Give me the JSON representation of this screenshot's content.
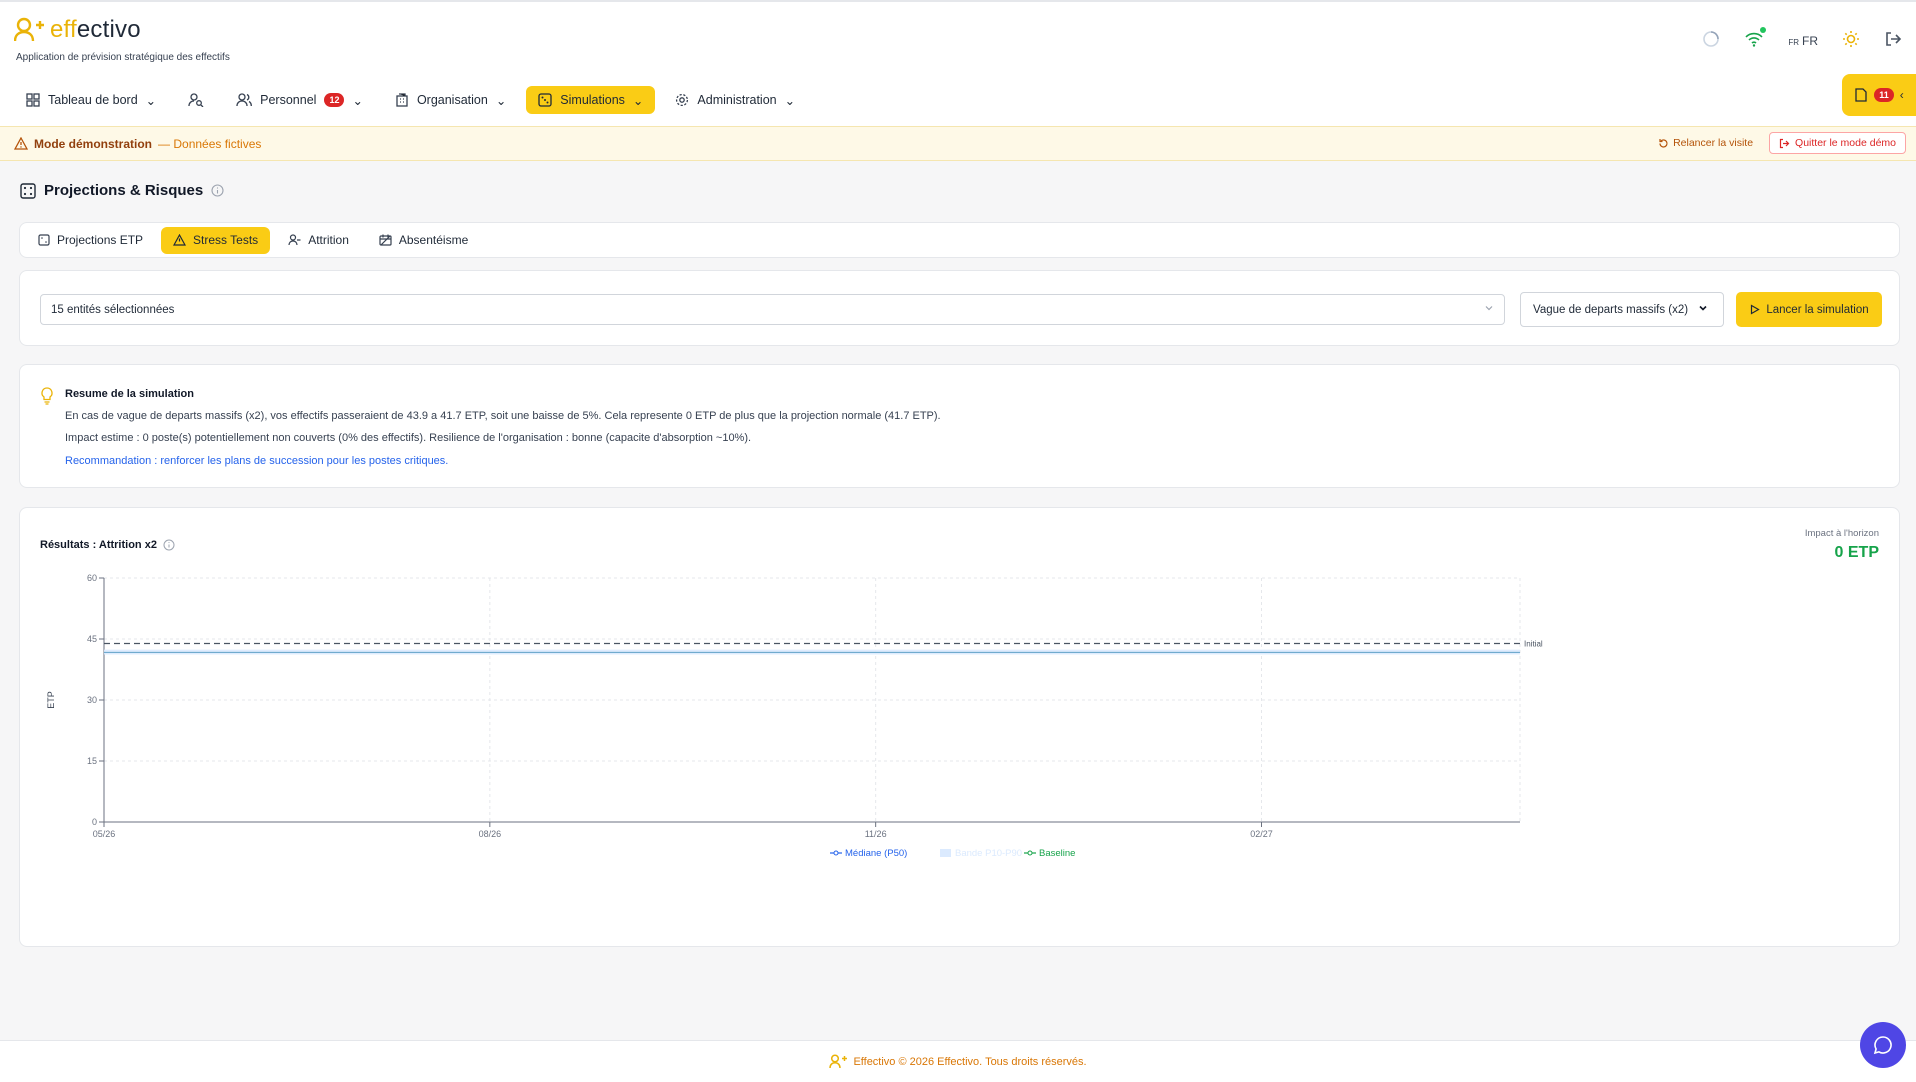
{
  "app": {
    "brand_prefix": "eff",
    "brand_suffix": "ectivo",
    "tagline": "Application de prévision stratégique des effectifs",
    "lang_small": "FR",
    "lang": "FR",
    "accent": "#facc15"
  },
  "nav": {
    "items": [
      {
        "label": "Tableau de bord",
        "icon": "grid-icon"
      },
      {
        "label": "",
        "icon": "user-search-icon"
      },
      {
        "label": "Personnel",
        "icon": "users-icon",
        "badge": "12"
      },
      {
        "label": "Organisation",
        "icon": "building-icon"
      },
      {
        "label": "Simulations",
        "icon": "dice-icon",
        "active": true
      },
      {
        "label": "Administration",
        "icon": "gear-icon"
      }
    ]
  },
  "side_tab": {
    "badge": "11"
  },
  "demo": {
    "title": "Mode démonstration",
    "subtitle": "— Données fictives",
    "relaunch": "Relancer la visite",
    "quit": "Quitter le mode démo"
  },
  "page": {
    "title": "Projections & Risques"
  },
  "tabs": [
    {
      "label": "Projections ETP"
    },
    {
      "label": "Stress Tests",
      "active": true
    },
    {
      "label": "Attrition"
    },
    {
      "label": "Absentéisme"
    }
  ],
  "controls": {
    "entities": "15 entités sélectionnées",
    "scenario": "Vague de departs massifs (x2)",
    "run": "Lancer la simulation"
  },
  "summary": {
    "title": "Resume de la simulation",
    "line1": "En cas de vague de departs massifs (x2), vos effectifs passeraient de 43.9 a 41.7 ETP, soit une baisse de 5%. Cela represente 0 ETP de plus que la projection normale (41.7 ETP).",
    "line2": "Impact estime : 0 poste(s) potentiellement non couverts (0% des effectifs). Resilience de l'organisation : bonne (capacite d'absorption ~10%).",
    "reco": "Recommandation : renforcer les plans de succession pour les postes critiques."
  },
  "results": {
    "title": "Résultats : Attrition x2",
    "impact_label": "Impact à l'horizon",
    "impact_value": "0 ETP"
  },
  "chart_data": {
    "type": "line",
    "ylabel": "ETP",
    "ylim": [
      0,
      60
    ],
    "yticks": [
      "0",
      "15",
      "30",
      "45",
      "60"
    ],
    "xticks": [
      "05/26",
      "08/26",
      "11/26",
      "02/27"
    ],
    "grid": true,
    "series": [
      {
        "name": "Médiane (P50)",
        "color": "#2563eb",
        "values": [
          41.7,
          41.7,
          41.7,
          41.7,
          41.7
        ]
      },
      {
        "name": "Bande P10-P90",
        "color": "#dbeafe",
        "low": [
          41.2,
          41.2,
          41.2,
          41.2,
          41.2
        ],
        "high": [
          42.4,
          42.4,
          42.4,
          42.4,
          42.4
        ]
      },
      {
        "name": "Baseline",
        "color": "#16a34a",
        "values": [
          41.7,
          41.7,
          41.7,
          41.7,
          41.7
        ]
      }
    ],
    "reference_line": {
      "label": "Initial",
      "value": 43.9
    },
    "legend_position": "bottom"
  },
  "footer": {
    "text": "Effectivo © 2026 Effectivo. Tous droits réservés."
  }
}
